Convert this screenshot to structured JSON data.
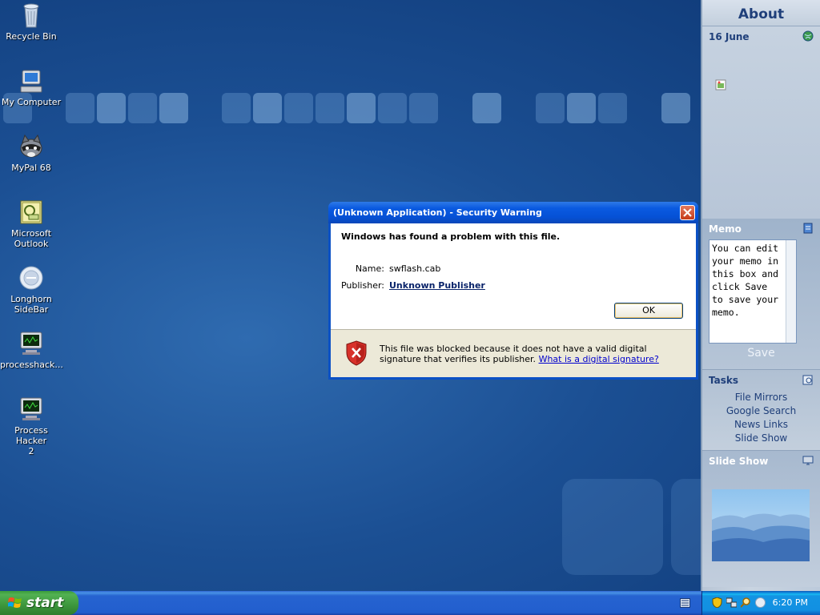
{
  "desktop": {
    "icons": [
      {
        "label": "Recycle Bin",
        "icon": "recycle-bin-icon"
      },
      {
        "label": "My Computer",
        "icon": "computer-icon"
      },
      {
        "label": "MyPal 68",
        "icon": "raccoon-browser-icon"
      },
      {
        "label_line1": "Microsoft",
        "label_line2": "Outlook",
        "icon": "outlook-icon"
      },
      {
        "label_line1": "Longhorn",
        "label_line2": "SideBar",
        "icon": "sidebar-icon"
      },
      {
        "label": "processhack...",
        "icon": "process-hacker-icon"
      },
      {
        "label_line1": "Process Hacker",
        "label_line2": "2",
        "icon": "process-hacker-icon"
      }
    ]
  },
  "sidebar": {
    "title": "About",
    "calendar": {
      "date": "16 June",
      "icon": "globe-icon"
    },
    "memo": {
      "heading": "Memo",
      "lines": [
        "You can edit",
        "your memo in",
        "this box and",
        "click Save",
        "to save your",
        "memo."
      ],
      "save_label": "Save",
      "icon": "notepad-icon"
    },
    "tasks": {
      "heading": "Tasks",
      "icon": "tasks-icon",
      "items": [
        "File Mirrors",
        "Google Search",
        "News Links",
        "Slide Show"
      ]
    },
    "slideshow": {
      "heading": "Slide Show",
      "icon": "monitor-icon"
    }
  },
  "dialog": {
    "title": "(Unknown Application) - Security Warning",
    "heading": "Windows has found a problem with this file.",
    "name_label": "Name:",
    "name_value": "swflash.cab",
    "publisher_label": "Publisher:",
    "publisher_value": "Unknown Publisher",
    "ok_label": "OK",
    "message": "This file was blocked because it does not have a valid digital signature that verifies its publisher.",
    "message_link": "What is a digital signature?"
  },
  "taskbar": {
    "start_label": "start",
    "clock": "6:20 PM"
  },
  "colors": {
    "desktop": "#1b4f93",
    "dialog_titlebar": "#0551d6",
    "start_green": "#3c963c",
    "link": "#0000cc"
  }
}
